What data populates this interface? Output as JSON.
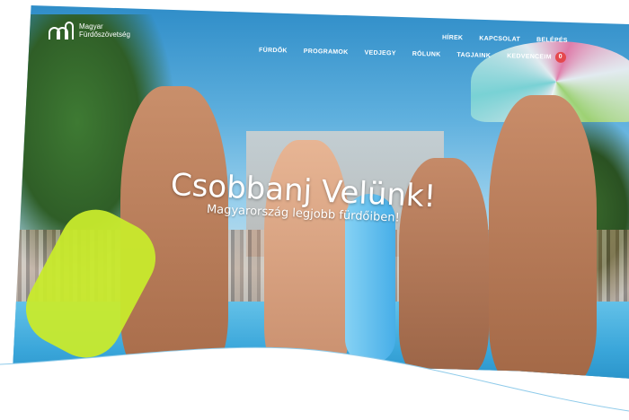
{
  "logo": {
    "line1": "Magyar",
    "line2": "Fürdőszövetség"
  },
  "nav_top": [
    "HÍREK",
    "KAPCSOLAT",
    "BELÉPÉS"
  ],
  "nav_main": [
    "FÜRDŐK",
    "PROGRAMOK",
    "VEDJEGY",
    "RÓLUNK",
    "TAGJAINK"
  ],
  "favorites": {
    "label": "KEDVENCEIM",
    "count": "0"
  },
  "hero": {
    "headline": "Csobbanj Velünk!",
    "subline": "Magyarország legjobb fürdőiben!"
  },
  "colors": {
    "accent": "#e5484d",
    "water": "#3aa6da"
  }
}
